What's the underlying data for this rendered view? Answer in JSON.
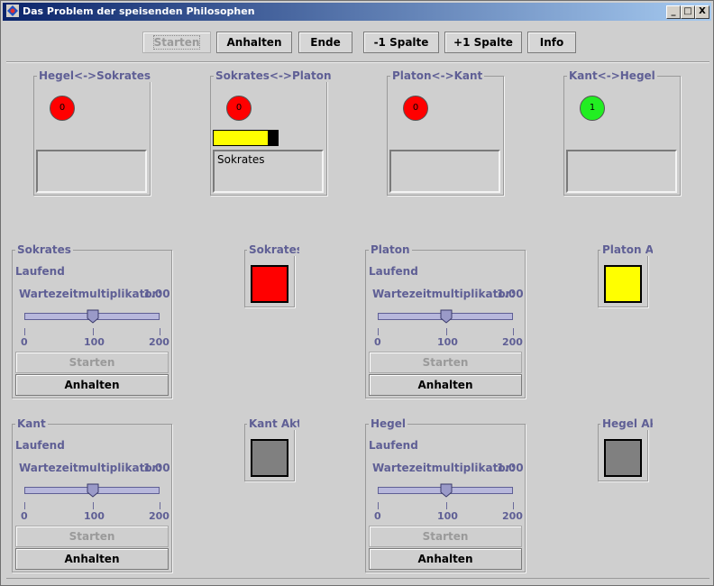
{
  "window": {
    "title": "Das Problem der speisenden Philosophen",
    "min_label": "_",
    "max_label": "□",
    "close_label": "X"
  },
  "toolbar": {
    "start": "Starten",
    "pause": "Anhalten",
    "end": "Ende",
    "minus_col": "-1 Spalte",
    "plus_col": "+1 Spalte",
    "info": "Info"
  },
  "forks": [
    {
      "label": "Hegel<->Sokrates",
      "count": "0",
      "color": "#ff0000",
      "text": ""
    },
    {
      "label": "Sokrates<->Platon",
      "count": "0",
      "color": "#ff0000",
      "text": "Sokrates",
      "progress": 0.85
    },
    {
      "label": "Platon<->Kant",
      "count": "0",
      "color": "#ff0000",
      "text": ""
    },
    {
      "label": "Kant<->Hegel",
      "count": "1",
      "color": "#22ee22",
      "text": ""
    }
  ],
  "philosophers": [
    {
      "name": "Sokrates",
      "status": "Laufend",
      "multiplier_label": "Wartezeitmultiplikator:",
      "multiplier": "1.00",
      "slider_value": 100,
      "min": "0",
      "mid": "100",
      "max": "200",
      "start": "Starten",
      "pause": "Anhalten",
      "activity_label": "Sokrates",
      "activity_color": "#ff0000"
    },
    {
      "name": "Platon",
      "status": "Laufend",
      "multiplier_label": "Wartezeitmultiplikator:",
      "multiplier": "1.00",
      "slider_value": 100,
      "min": "0",
      "mid": "100",
      "max": "200",
      "start": "Starten",
      "pause": "Anhalten",
      "activity_label": "Platon Ak",
      "activity_color": "#ffff00"
    },
    {
      "name": "Kant",
      "status": "Laufend",
      "multiplier_label": "Wartezeitmultiplikator:",
      "multiplier": "1.00",
      "slider_value": 100,
      "min": "0",
      "mid": "100",
      "max": "200",
      "start": "Starten",
      "pause": "Anhalten",
      "activity_label": "Kant Akti",
      "activity_color": "#808080"
    },
    {
      "name": "Hegel",
      "status": "Laufend",
      "multiplier_label": "Wartezeitmultiplikator:",
      "multiplier": "1.00",
      "slider_value": 100,
      "min": "0",
      "mid": "100",
      "max": "200",
      "start": "Starten",
      "pause": "Anhalten",
      "activity_label": "Hegel Akt",
      "activity_color": "#808080"
    }
  ]
}
